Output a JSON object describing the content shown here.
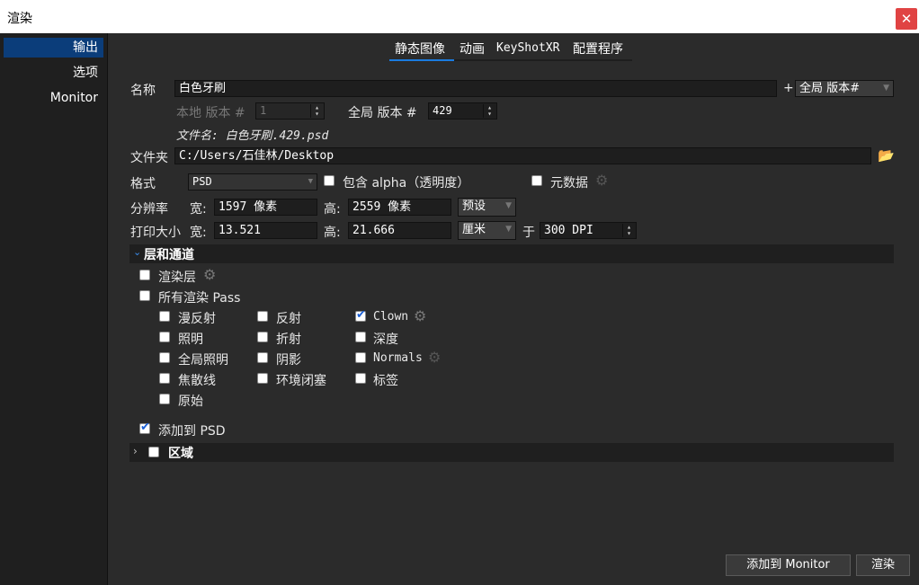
{
  "window": {
    "title": "渲染",
    "close": "✕"
  },
  "sidebar": {
    "items": [
      {
        "label": "输出"
      },
      {
        "label": "选项"
      },
      {
        "label": "Monitor"
      }
    ]
  },
  "tabs": [
    {
      "label": "静态图像"
    },
    {
      "label": "动画"
    },
    {
      "label": "KeyShotXR"
    },
    {
      "label": "配置程序"
    }
  ],
  "name": {
    "label": "名称",
    "value": "白色牙刷",
    "plus": "+",
    "suffix_select": "全局 版本#"
  },
  "local_version": {
    "label": "本地 版本 #",
    "value": "1"
  },
  "global_version": {
    "label": "全局 版本 #",
    "value": "429"
  },
  "filename": "文件名: 白色牙刷.429.psd",
  "folder": {
    "label": "文件夹",
    "value": "C:/Users/石佳林/Desktop"
  },
  "format": {
    "label": "格式",
    "value": "PSD",
    "alpha_label": "包含 alpha（透明度）",
    "metadata_label": "元数据"
  },
  "resolution": {
    "label": "分辨率",
    "w_label": "宽:",
    "w": "1597 像素",
    "h_label": "高:",
    "h": "2559 像素",
    "preset": "预设"
  },
  "print_size": {
    "label": "打印大小",
    "w_label": "宽:",
    "w": "13.521",
    "h_label": "高:",
    "h": "21.666",
    "unit": "厘米",
    "at": "于",
    "dpi": "300 DPI"
  },
  "layers": {
    "title": "层和通道",
    "render_layers": "渲染层",
    "all_passes": "所有渲染 Pass",
    "passes": [
      [
        "漫反射",
        "照明",
        "全局照明",
        "焦散线",
        "原始"
      ],
      [
        "反射",
        "折射",
        "阴影",
        "环境闭塞"
      ],
      [
        "Clown",
        "深度",
        "Normals",
        "标签"
      ]
    ],
    "add_to_psd": "添加到 PSD"
  },
  "region": {
    "title": "区域"
  },
  "buttons": {
    "add_monitor": "添加到 Monitor",
    "render": "渲染"
  }
}
